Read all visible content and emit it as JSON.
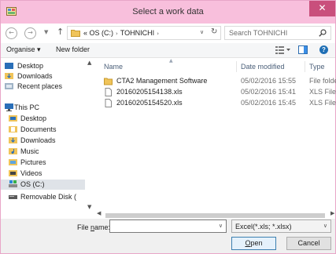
{
  "window": {
    "title": "Select a work data",
    "close_glyph": "✕"
  },
  "navigation": {
    "back_glyph": "←",
    "forward_glyph": "→",
    "up_glyph": "↑",
    "address": {
      "overflow": "«",
      "path": [
        "OS (C:)",
        "TOHNICHI"
      ],
      "separator": "›"
    },
    "search_placeholder": "Search TOHNICHI"
  },
  "toolbar": {
    "organise_label": "Organise ▾",
    "new_folder_label": "New folder",
    "help_glyph": "?"
  },
  "sidebar": {
    "items": [
      {
        "label": "Desktop",
        "icon": "desktop-icon"
      },
      {
        "label": "Downloads",
        "icon": "downloads-icon"
      },
      {
        "label": "Recent places",
        "icon": "recent-places-icon"
      },
      {
        "label": "This PC",
        "icon": "this-pc-icon"
      },
      {
        "label": "Desktop",
        "icon": "desktop-folder-icon"
      },
      {
        "label": "Documents",
        "icon": "documents-icon"
      },
      {
        "label": "Downloads",
        "icon": "downloads-icon"
      },
      {
        "label": "Music",
        "icon": "music-icon"
      },
      {
        "label": "Pictures",
        "icon": "pictures-icon"
      },
      {
        "label": "Videos",
        "icon": "videos-icon"
      },
      {
        "label": "OS (C:)",
        "icon": "drive-icon",
        "selected": true
      },
      {
        "label": "Removable Disk (",
        "icon": "removable-disk-icon"
      }
    ]
  },
  "file_list": {
    "columns": [
      "Name",
      "Date modified",
      "Type"
    ],
    "rows": [
      {
        "name": "CTA2 Management Software",
        "date": "05/02/2016 15:55",
        "type": "File folder",
        "icon": "folder-icon"
      },
      {
        "name": "20160205154138.xls",
        "date": "05/02/2016 15:41",
        "type": "XLS File",
        "icon": "file-icon"
      },
      {
        "name": "20160205154520.xls",
        "date": "05/02/2016 15:45",
        "type": "XLS File",
        "icon": "file-icon"
      }
    ]
  },
  "footer": {
    "file_name_label_prefix": "File ",
    "file_name_label_accel": "n",
    "file_name_label_suffix": "ame:",
    "file_name_value": "",
    "file_type": "Excel(*.xls; *.xlsx)",
    "open_accel": "O",
    "open_rest": "pen",
    "cancel_label": "Cancel"
  },
  "colors": {
    "titlebar": "#f8bfdc",
    "close": "#c94f7c",
    "accent": "#1f6fb5"
  }
}
